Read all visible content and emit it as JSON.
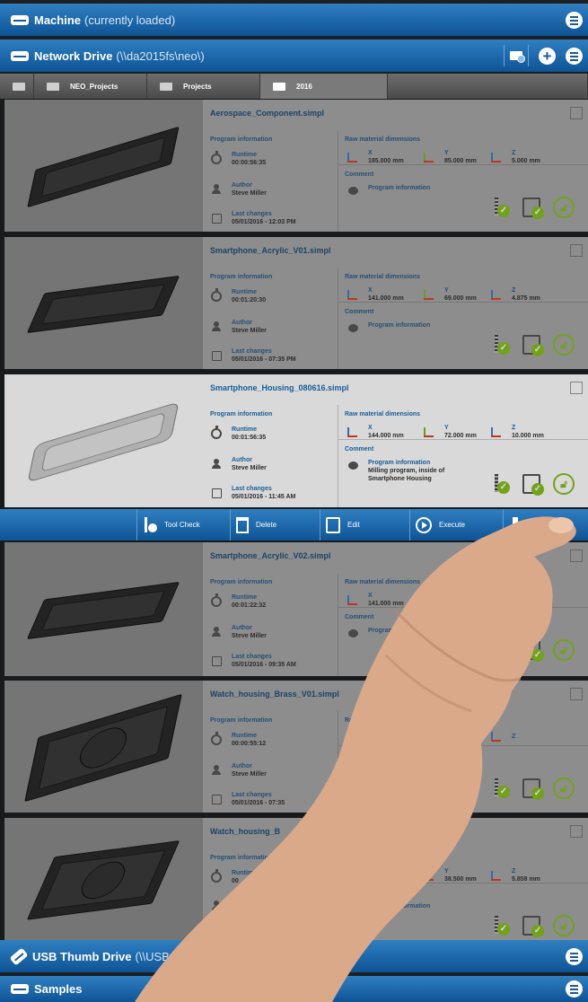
{
  "machine": {
    "title": "Machine",
    "subtitle": "(currently loaded)"
  },
  "network": {
    "title": "Network Drive",
    "subtitle": "(\\\\da2015fs\\neo\\)"
  },
  "breadcrumb": [
    "NEO_Projects",
    "Projects",
    "2016"
  ],
  "labels": {
    "program_information": "Program information",
    "raw_material": "Raw material dimensions",
    "runtime": "Runtime",
    "author": "Author",
    "last_changes": "Last changes",
    "comment": "Comment",
    "comment_title": "Program information",
    "x": "X",
    "y": "Y",
    "z": "Z"
  },
  "programs": [
    {
      "name": "Aerospace_Component.simpl",
      "runtime": "00:00:56:35",
      "author": "Steve Miller",
      "changed": "05/01/2016 - 12:03 PM",
      "x": "185.000 mm",
      "y": "85.000 mm",
      "z": "5.000 mm",
      "comment": ""
    },
    {
      "name": "Smartphone_Acrylic_V01.simpl",
      "runtime": "00:01:20:30",
      "author": "Steve Miller",
      "changed": "05/01/2016 - 07:35 PM",
      "x": "141.000 mm",
      "y": "69.000 mm",
      "z": "4.875 mm",
      "comment": ""
    },
    {
      "name": "Smartphone_Housing_080616.simpl",
      "runtime": "00:01:56:35",
      "author": "Steve Miller",
      "changed": "05/01/2016 - 11:45 AM",
      "x": "144.000 mm",
      "y": "72.000 mm",
      "z": "10.000 mm",
      "comment": "Milling program, inside of Smartphone Housing"
    },
    {
      "name": "Smartphone_Acrylic_V02.simpl",
      "runtime": "00:01:22:32",
      "author": "Steve Miller",
      "changed": "05/01/2016 - 09:35 AM",
      "x": "141.000 mm",
      "y": "",
      "z": "",
      "comment": ""
    },
    {
      "name": "Watch_housing_Brass_V01.simpl",
      "runtime": "00:00:55:12",
      "author": "Steve Miller",
      "changed": "05/01/2016 - 07:35",
      "x": "",
      "y": "",
      "z": "",
      "comment": ""
    },
    {
      "name": "Watch_housing_B",
      "runtime": "00",
      "author": "",
      "changed": "",
      "x": "",
      "y": "38.500 mm",
      "z": "5.858 mm",
      "comment": ""
    }
  ],
  "actions": {
    "tool_check": "Tool Check",
    "delete": "Delete",
    "edit": "Edit",
    "execute": "Execute"
  },
  "usb": {
    "title": "USB Thumb Drive",
    "subtitle": "(\\\\USB_32"
  },
  "samples": {
    "title": "Samples"
  },
  "colors": {
    "accent": "#1c6fb5",
    "bar": "#0e5496",
    "ok": "#86bf1f"
  }
}
